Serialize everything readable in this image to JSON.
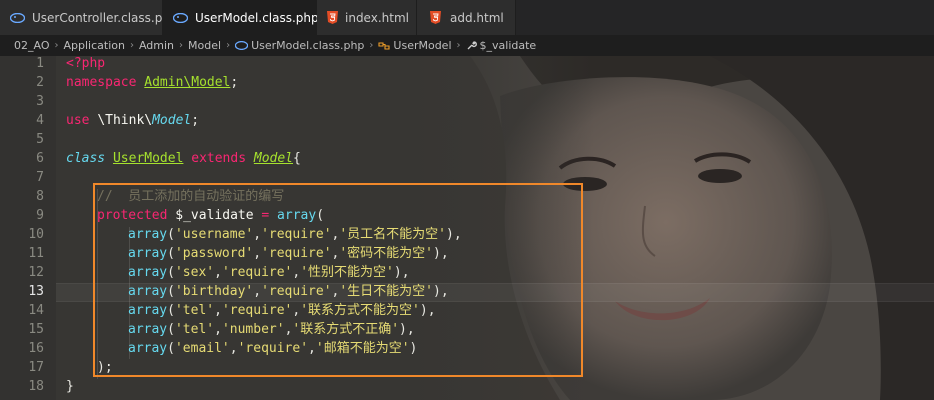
{
  "tabs": [
    {
      "label": "UserController.class.php",
      "icon": "php-elephant-icon",
      "active": false
    },
    {
      "label": "UserModel.class.php",
      "icon": "php-elephant-icon",
      "active": true,
      "close": "×"
    },
    {
      "label": "index.html",
      "icon": "html5-icon",
      "active": false
    },
    {
      "label": "add.html",
      "icon": "html5-icon",
      "active": false
    }
  ],
  "breadcrumb": {
    "items": [
      "02_AO",
      "Application",
      "Admin",
      "Model",
      "UserModel.class.php",
      "UserModel",
      "$_validate"
    ],
    "separator": "›"
  },
  "editor": {
    "current_line": 13,
    "lines": [
      {
        "n": "1"
      },
      {
        "n": "2"
      },
      {
        "n": "3"
      },
      {
        "n": "4"
      },
      {
        "n": "5"
      },
      {
        "n": "6"
      },
      {
        "n": "7"
      },
      {
        "n": "8"
      },
      {
        "n": "9"
      },
      {
        "n": "10"
      },
      {
        "n": "11"
      },
      {
        "n": "12"
      },
      {
        "n": "13"
      },
      {
        "n": "14"
      },
      {
        "n": "15"
      },
      {
        "n": "16"
      },
      {
        "n": "17"
      },
      {
        "n": "18"
      }
    ],
    "tokens": {
      "php_open": "<?php",
      "namespace_kw": "namespace",
      "namespace_name": "Admin\\Model",
      "semicolon": ";",
      "use_kw": "use",
      "use_path_a": "\\Think\\",
      "use_path_b": "Model",
      "class_kw": "class",
      "class_name": "UserModel",
      "extends_kw": "extends",
      "parent_class": "Model",
      "brace_open": "{",
      "comment": "//  员工添加的自动验证的编写",
      "protected_kw": "protected",
      "prop_name": "$_validate",
      "assign": "=",
      "array_fn": "array",
      "paren_open": "(",
      "close_stmt": ");",
      "brace_close": "}"
    },
    "rules": [
      {
        "field": "'username'",
        "rule": "'require'",
        "msg": "'员工名不能为空'",
        "tail": "),"
      },
      {
        "field": "'password'",
        "rule": "'require'",
        "msg": "'密码不能为空'",
        "tail": "),"
      },
      {
        "field": "'sex'",
        "rule": "'require'",
        "msg": "'性别不能为空'",
        "tail": "),"
      },
      {
        "field": "'birthday'",
        "rule": "'require'",
        "msg": "'生日不能为空'",
        "tail": "),"
      },
      {
        "field": "'tel'",
        "rule": "'require'",
        "msg": "'联系方式不能为空'",
        "tail": "),"
      },
      {
        "field": "'tel'",
        "rule": "'number'",
        "msg": "'联系方式不正确'",
        "tail": "),"
      },
      {
        "field": "'email'",
        "rule": "'require'",
        "msg": "'邮箱不能为空'",
        "tail": ")"
      }
    ]
  },
  "colors": {
    "highlight_box": "#f0882a",
    "keyword": "#f92672",
    "string": "#e6db74",
    "type": "#66d9ef",
    "class_name": "#a6e22e",
    "comment": "#75715e"
  }
}
